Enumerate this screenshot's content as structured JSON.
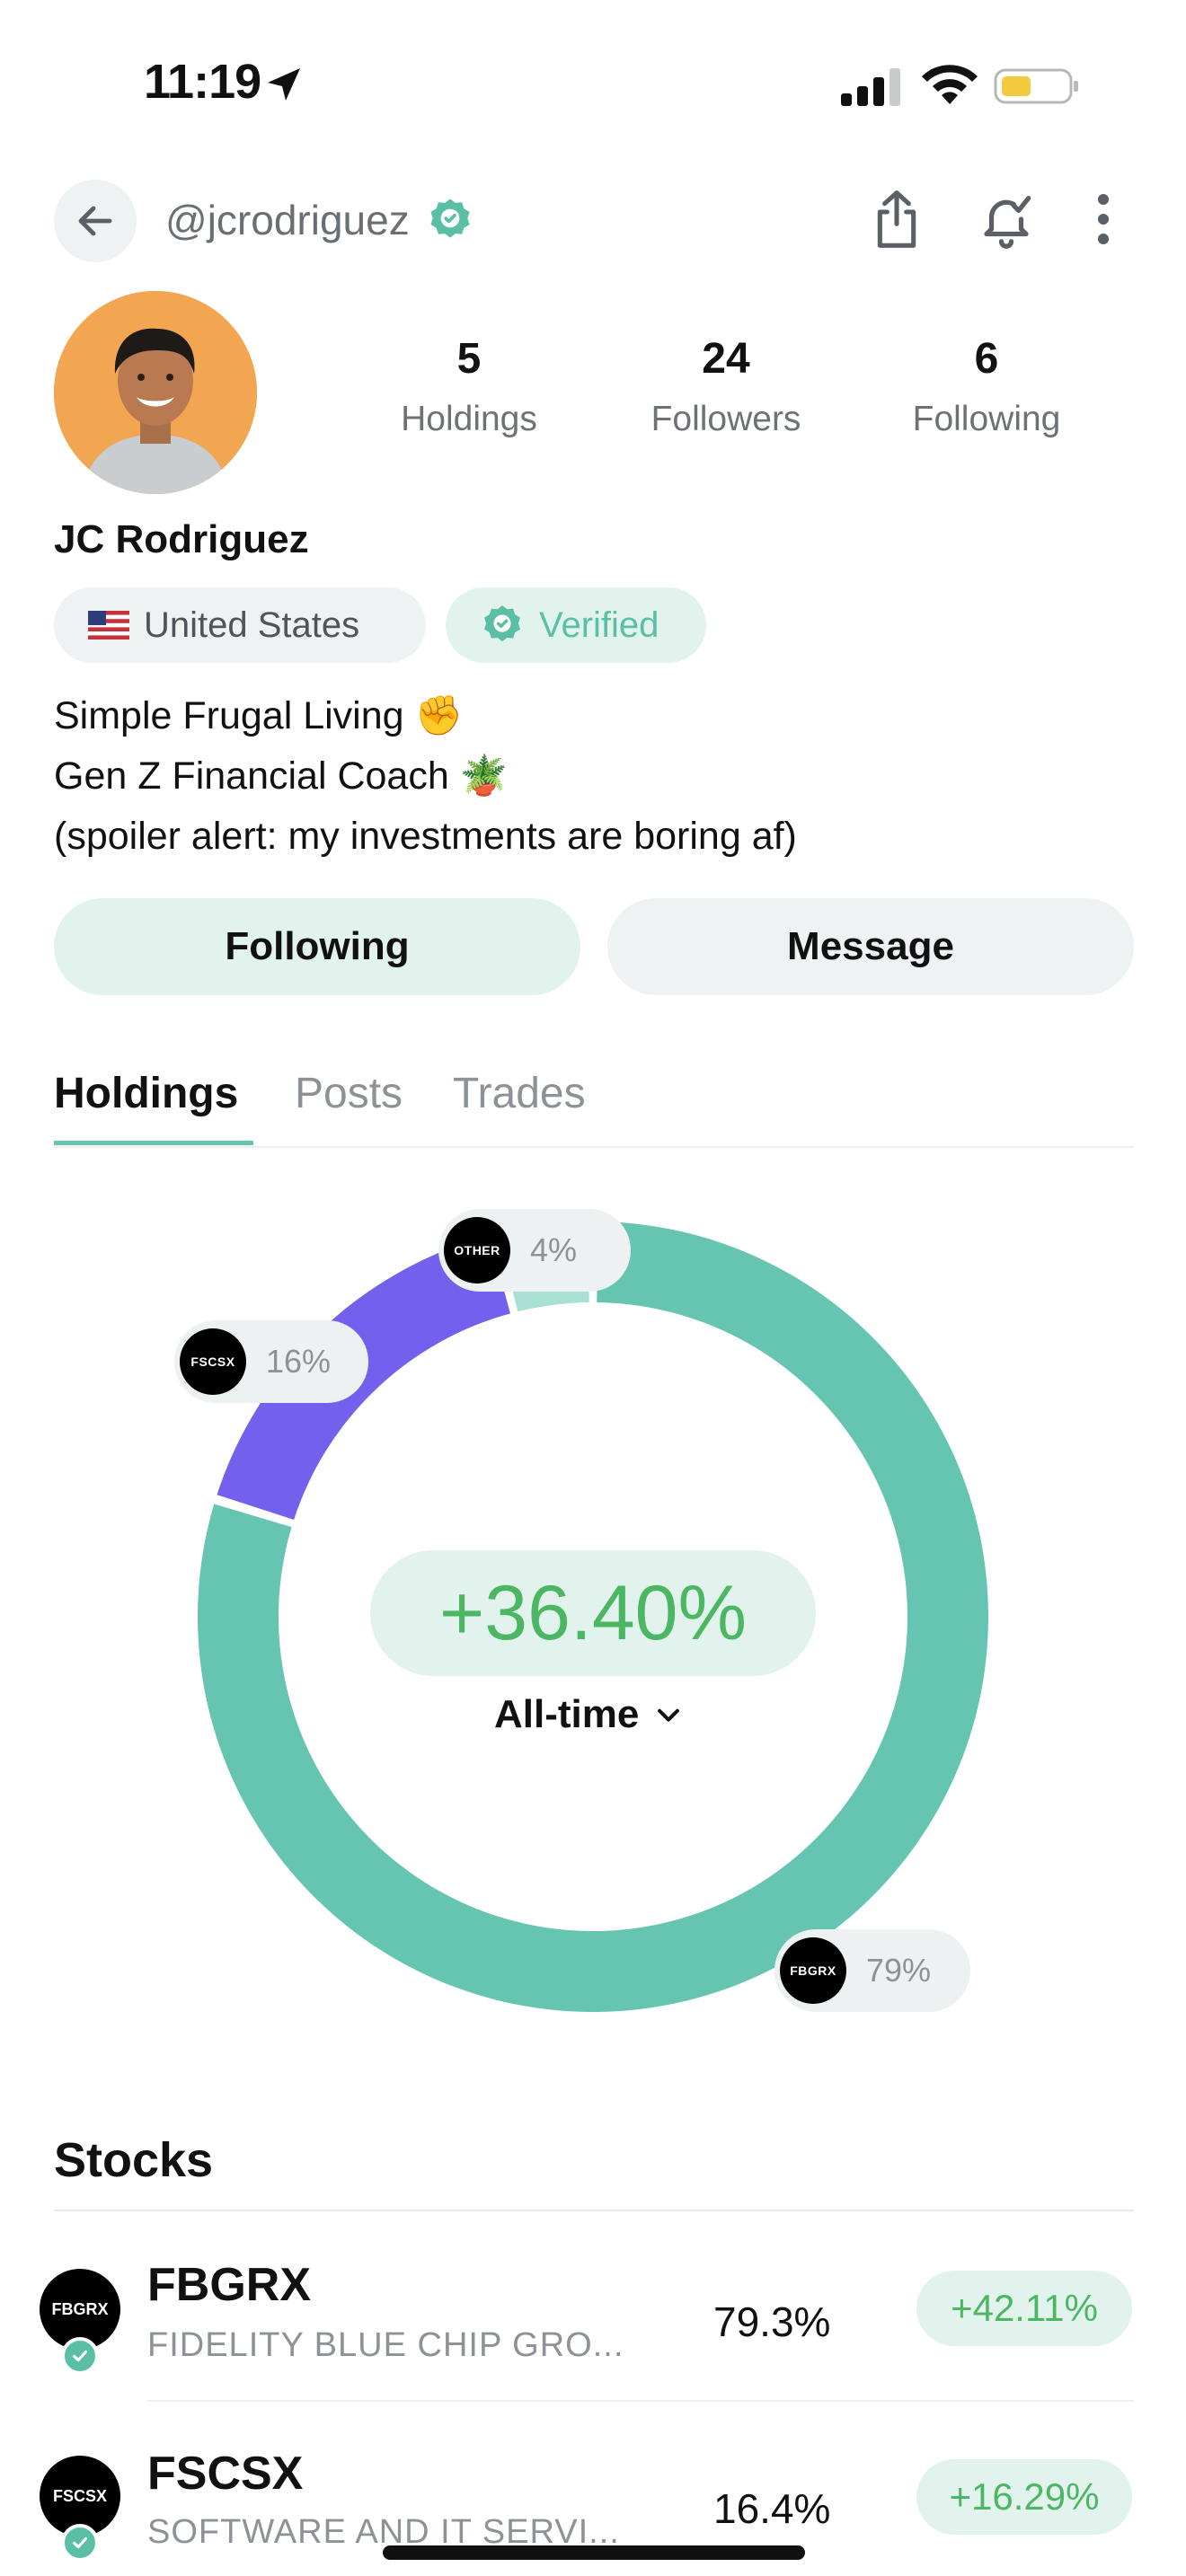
{
  "status_bar": {
    "time": "11:19"
  },
  "header": {
    "username": "@jcrodriguez"
  },
  "profile": {
    "stats": [
      {
        "value": "5",
        "label": "Holdings"
      },
      {
        "value": "24",
        "label": "Followers"
      },
      {
        "value": "6",
        "label": "Following"
      }
    ],
    "name": "JC Rodriguez",
    "country": "United States",
    "verified_label": "Verified",
    "bio": [
      "Simple Frugal Living ✊",
      "Gen Z Financial Coach 🪴",
      "(spoiler alert: my investments are boring af)"
    ],
    "following_button": "Following",
    "message_button": "Message"
  },
  "tabs": [
    "Holdings",
    "Posts",
    "Trades"
  ],
  "portfolio": {
    "return": "+36.40%",
    "period": "All-time",
    "segment_labels": [
      {
        "ticker": "OTHER",
        "pct": "4%"
      },
      {
        "ticker": "FSCSX",
        "pct": "16%"
      },
      {
        "ticker": "FBGRX",
        "pct": "79%"
      }
    ]
  },
  "chart_data": {
    "type": "pie",
    "categories": [
      "FBGRX",
      "FSCSX",
      "OTHER"
    ],
    "values": [
      79,
      16,
      4
    ],
    "colors": [
      "#66c5b1",
      "#7361ee",
      "#a8e0d4"
    ]
  },
  "stocks": {
    "title": "Stocks",
    "items": [
      {
        "ticker": "FBGRX",
        "name": "FIDELITY BLUE CHIP GRO...",
        "allocation": "79.3%",
        "gain": "+42.11%"
      },
      {
        "ticker": "FSCSX",
        "name": "SOFTWARE AND IT SERVI...",
        "allocation": "16.4%",
        "gain": "+16.29%"
      }
    ]
  },
  "colors": {
    "accent": "#66c5b1",
    "positive": "#4cb763",
    "purple": "#7361ee"
  }
}
